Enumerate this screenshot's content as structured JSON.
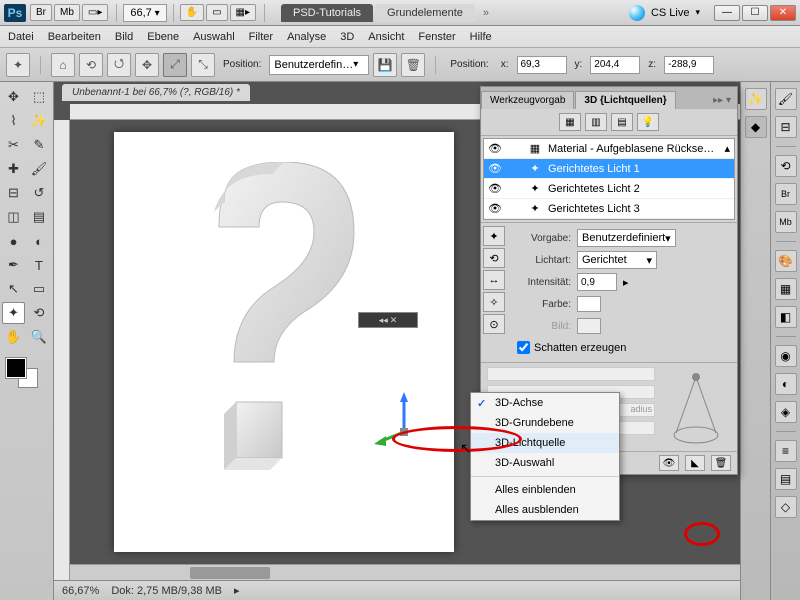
{
  "titlebar": {
    "ps": "Ps",
    "br": "Br",
    "mb": "Mb",
    "zoom": "66,7",
    "tabs": [
      "PSD-Tutorials",
      "Grundelemente"
    ],
    "cslive": "CS Live"
  },
  "menu": [
    "Datei",
    "Bearbeiten",
    "Bild",
    "Ebene",
    "Auswahl",
    "Filter",
    "Analyse",
    "3D",
    "Ansicht",
    "Fenster",
    "Hilfe"
  ],
  "optbar": {
    "pos_label": "Position:",
    "pos_preset": "Benutzerdefin…",
    "pos2_label": "Position:",
    "x_label": "x:",
    "x": "69,3",
    "y_label": "y:",
    "y": "204,4",
    "z_label": "z:",
    "z": "-288,9"
  },
  "doc_tab": "Unbenannt-1 bei 66,7% (?, RGB/16) *",
  "status": {
    "zoom": "66,67%",
    "dok_label": "Dok:",
    "dok": "2,75 MB/9,38 MB"
  },
  "panel3d": {
    "tabs": [
      "Werkzeugvorgab",
      "3D {Lichtquellen}"
    ],
    "list": [
      {
        "label": "Material - Aufgeblasene Rückse…",
        "icon": "▦",
        "sel": false,
        "indent": 1
      },
      {
        "label": "Gerichtetes Licht 1",
        "icon": "✦",
        "sel": true,
        "indent": 1
      },
      {
        "label": "Gerichtetes Licht 2",
        "icon": "✦",
        "sel": false,
        "indent": 1
      },
      {
        "label": "Gerichtetes Licht 3",
        "icon": "✦",
        "sel": false,
        "indent": 1
      }
    ],
    "vorgabe_label": "Vorgabe:",
    "vorgabe": "Benutzerdefiniert",
    "lichtart_label": "Lichtart:",
    "lichtart": "Gerichtet",
    "intensitaet_label": "Intensität:",
    "intensitaet": "0,9",
    "farbe_label": "Farbe:",
    "bild_label": "Bild:",
    "schatten": "Schatten erzeugen",
    "radius": "adius"
  },
  "ctx": {
    "items": [
      "3D-Achse",
      "3D-Grundebene",
      "3D-Lichtquelle",
      "3D-Auswahl"
    ],
    "items2": [
      "Alles einblenden",
      "Alles ausblenden"
    ],
    "checked": 0,
    "highlighted": 2
  }
}
